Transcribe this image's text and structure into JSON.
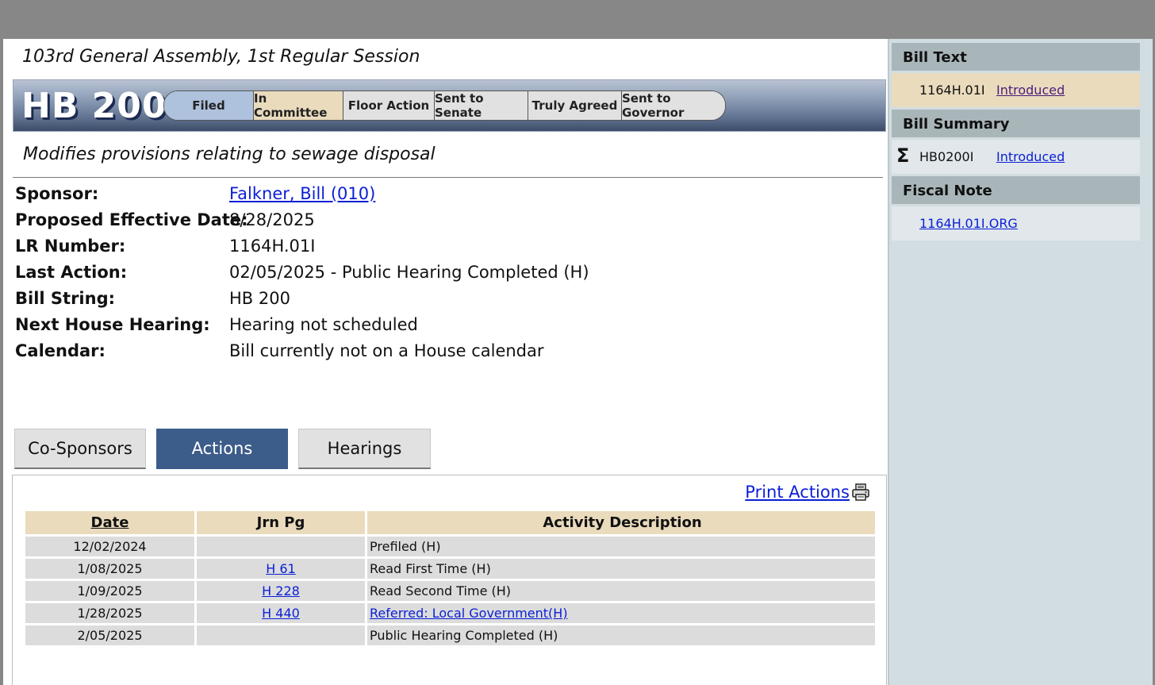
{
  "session": {
    "title": "103rd General Assembly, 1st Regular Session"
  },
  "bill": {
    "number": "HB 200",
    "description": "Modifies provisions relating to sewage disposal"
  },
  "status_steps": [
    {
      "label": "Filed",
      "state": "done"
    },
    {
      "label": "In Committee",
      "state": "current"
    },
    {
      "label": "Floor Action",
      "state": "pending"
    },
    {
      "label": "Sent to Senate",
      "state": "pending"
    },
    {
      "label": "Truly Agreed",
      "state": "pending"
    },
    {
      "label": "Sent to Governor",
      "state": "pending"
    }
  ],
  "details": {
    "sponsor_label": "Sponsor:",
    "sponsor_value": "Falkner, Bill (010)",
    "effective_label": "Proposed Effective Date:",
    "effective_value": "8/28/2025",
    "lr_label": "LR Number:",
    "lr_value": "1164H.01I",
    "last_action_label": "Last Action:",
    "last_action_value": "02/05/2025 - Public Hearing Completed (H)",
    "bill_string_label": "Bill String:",
    "bill_string_value": "HB 200",
    "hearing_label": "Next House Hearing:",
    "hearing_value": "Hearing not scheduled",
    "calendar_label": "Calendar:",
    "calendar_value": "Bill currently not on a House calendar"
  },
  "tabs": {
    "cosponsors": "Co-Sponsors",
    "actions": "Actions",
    "hearings": "Hearings"
  },
  "actions": {
    "print_label": "Print Actions",
    "headers": {
      "date": "Date",
      "jrn": "Jrn Pg",
      "desc": "Activity Description"
    },
    "rows": [
      {
        "date": "12/02/2024",
        "jrn": "",
        "desc": "Prefiled (H)"
      },
      {
        "date": "1/08/2025",
        "jrn": "H 61",
        "desc": "Read First Time (H)"
      },
      {
        "date": "1/09/2025",
        "jrn": "H 228",
        "desc": "Read Second Time (H)"
      },
      {
        "date": "1/28/2025",
        "jrn": "H 440",
        "desc": "Referred: Local Government(H)"
      },
      {
        "date": "2/05/2025",
        "jrn": "",
        "desc": "Public Hearing Completed (H)"
      }
    ]
  },
  "sidebar": {
    "bill_text_header": "Bill Text",
    "bill_text_code": "1164H.01I",
    "bill_text_link": "Introduced",
    "bill_summary_header": "Bill Summary",
    "bill_summary_code": "HB0200I",
    "bill_summary_link": "Introduced",
    "fiscal_note_header": "Fiscal Note",
    "fiscal_note_link": "1164H.01I.ORG"
  },
  "icons": {
    "printer": "printer-icon",
    "summary": "sigma-icon"
  },
  "colors": {
    "tab_active": "#3c5c8a",
    "table_header": "#eadbbd",
    "step_done": "#aec2de",
    "step_current": "#eadbbd",
    "link": "#0a1fd6"
  }
}
